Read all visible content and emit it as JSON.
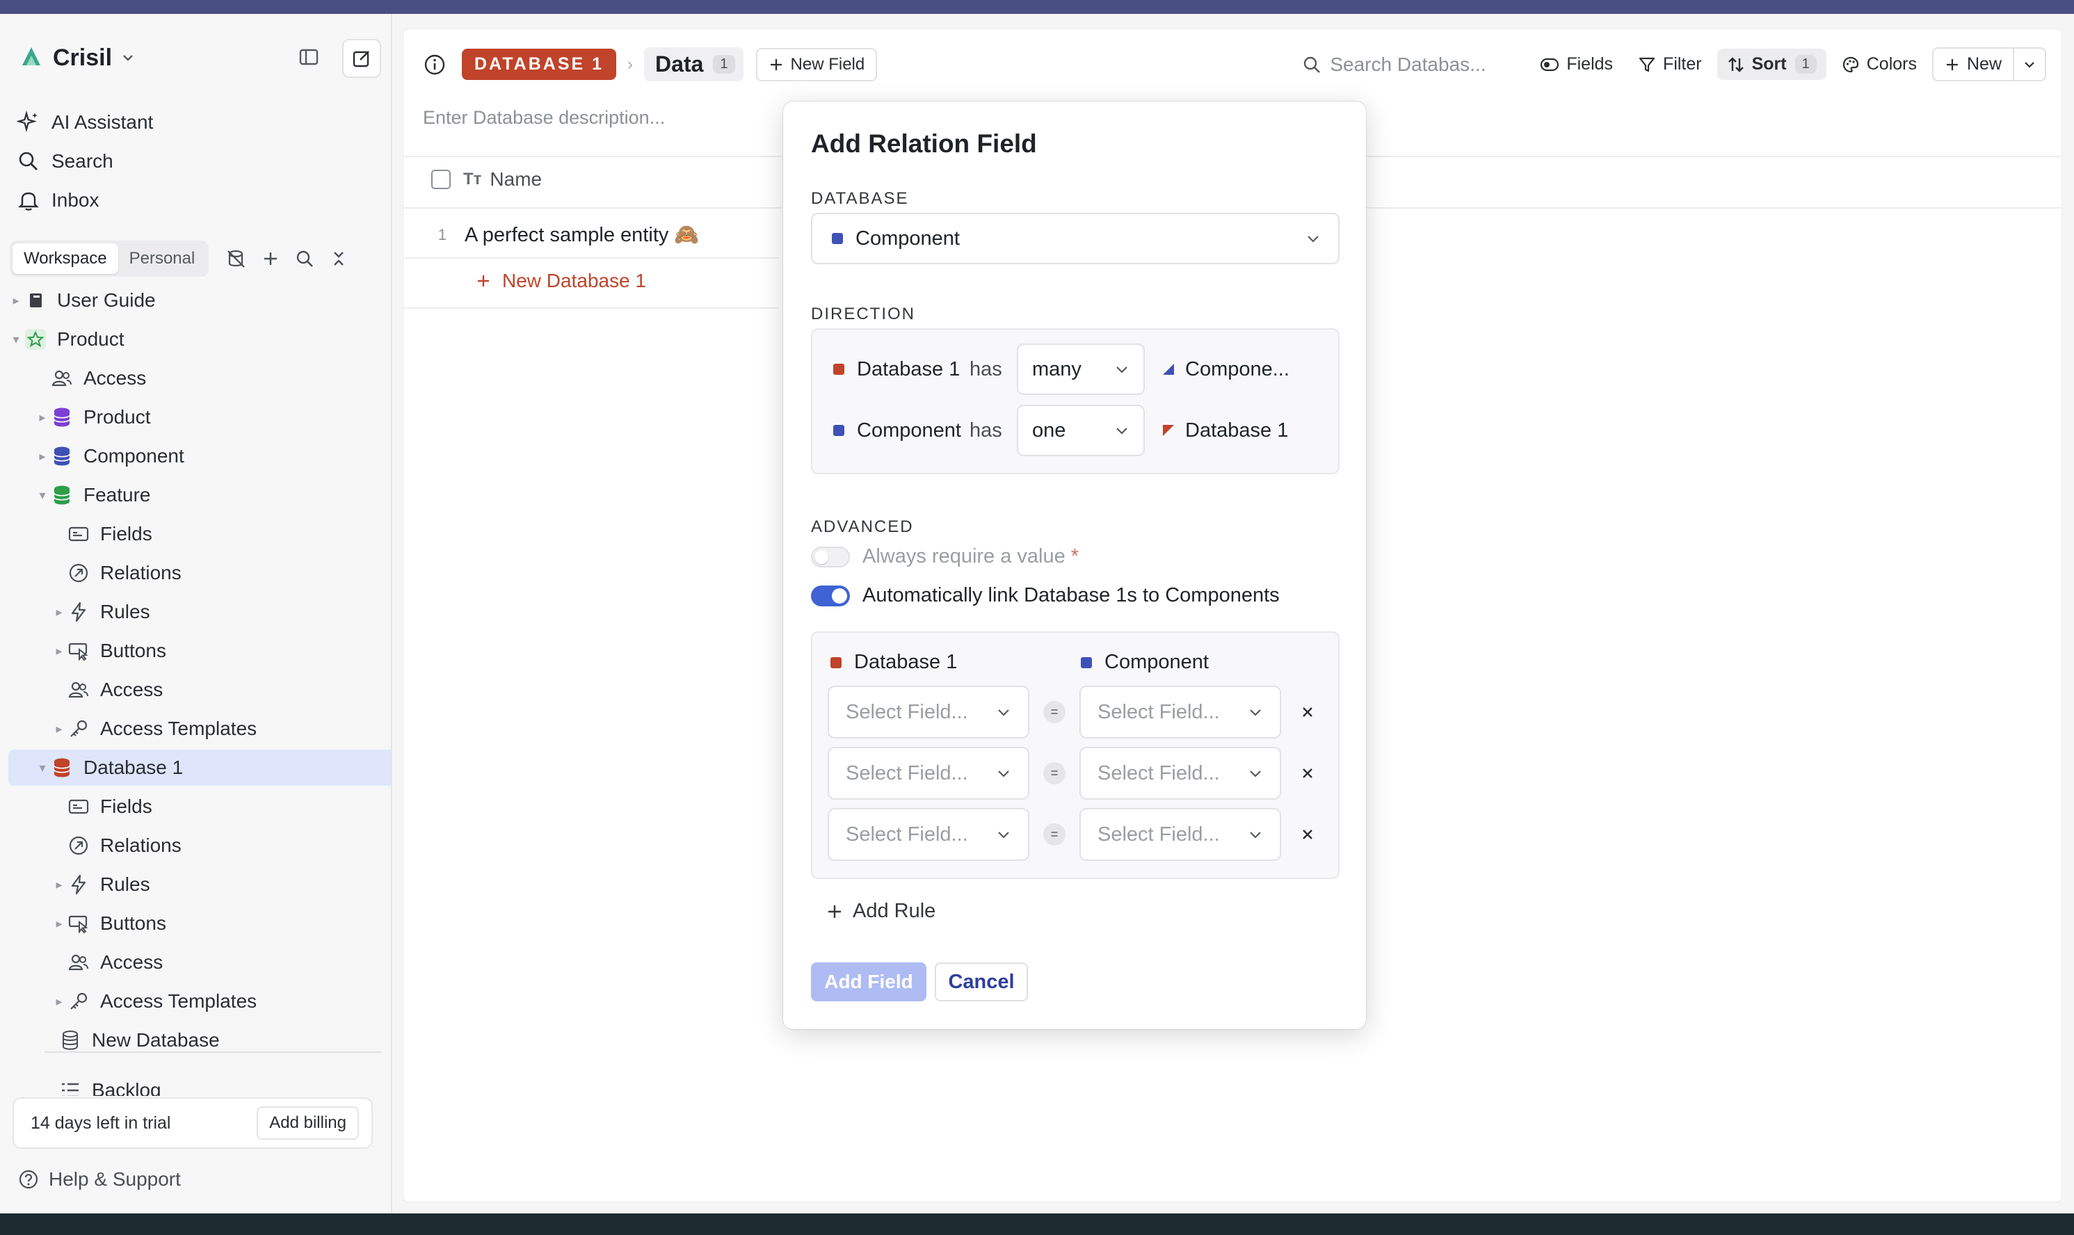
{
  "sidebar": {
    "workspace_name": "Crisil",
    "nav": [
      {
        "label": "AI Assistant",
        "icon": "sparkle-icon"
      },
      {
        "label": "Search",
        "icon": "search-icon"
      },
      {
        "label": "Inbox",
        "icon": "bell-icon"
      }
    ],
    "scope_tabs": [
      "Workspace",
      "Personal"
    ],
    "active_scope": "Workspace",
    "tree": [
      {
        "label": "User Guide",
        "icon": "book-icon"
      },
      {
        "label": "Product",
        "icon": "star-icon"
      },
      {
        "label": "Access",
        "icon": "users-icon"
      },
      {
        "label": "Product",
        "icon": "database-icon",
        "color": "#7b3fd4"
      },
      {
        "label": "Component",
        "icon": "database-icon",
        "color": "#3f51b5"
      },
      {
        "label": "Feature",
        "icon": "database-icon",
        "color": "#2e9e4a"
      },
      {
        "label": "Fields",
        "icon": "fields-icon"
      },
      {
        "label": "Relations",
        "icon": "relations-icon"
      },
      {
        "label": "Rules",
        "icon": "bolt-icon"
      },
      {
        "label": "Buttons",
        "icon": "cursor-icon"
      },
      {
        "label": "Access",
        "icon": "users-icon"
      },
      {
        "label": "Access Templates",
        "icon": "key-icon"
      },
      {
        "label": "Database 1",
        "icon": "database-icon",
        "color": "#c0432a"
      },
      {
        "label": "Fields",
        "icon": "fields-icon"
      },
      {
        "label": "Relations",
        "icon": "relations-icon"
      },
      {
        "label": "Rules",
        "icon": "bolt-icon"
      },
      {
        "label": "Buttons",
        "icon": "cursor-icon"
      },
      {
        "label": "Access",
        "icon": "users-icon"
      },
      {
        "label": "Access Templates",
        "icon": "key-icon"
      },
      {
        "label": "New Database",
        "icon": "database-outline-icon"
      },
      {
        "label": "Backlog",
        "icon": "list-icon"
      }
    ],
    "trial_days": "14 days",
    "trial_suffix": " left in trial",
    "add_billing": "Add billing",
    "help": "Help & Support"
  },
  "header": {
    "database_badge": "DATABASE 1",
    "view_name": "Data",
    "view_count": "1",
    "new_field": "New Field",
    "search_placeholder": "Search Databas...",
    "fields": "Fields",
    "filter": "Filter",
    "sort": "Sort",
    "sort_count": "1",
    "colors": "Colors",
    "new": "New"
  },
  "table": {
    "description_placeholder": "Enter Database description...",
    "column_name": "Name",
    "rows": [
      {
        "num": "1",
        "name": "A perfect sample entity 🙈"
      }
    ],
    "new_row": "New Database 1"
  },
  "modal": {
    "title": "Add Relation Field",
    "database_label": "DATABASE",
    "database_value": "Component",
    "direction_label": "DIRECTION",
    "direction": [
      {
        "source": "Database 1",
        "has": "has",
        "cardinality": "many",
        "target": "Compone..."
      },
      {
        "source": "Component",
        "has": "has",
        "cardinality": "one",
        "target": "Database 1"
      }
    ],
    "advanced_label": "ADVANCED",
    "require_value": "Always require a value",
    "require_star": "*",
    "require_value_on": false,
    "auto_link": "Automatically link Database 1s to Components",
    "auto_link_on": true,
    "rules_left_header": "Database 1",
    "rules_right_header": "Component",
    "rules": [
      {
        "left": "Select Field...",
        "op": "=",
        "right": "Select Field..."
      },
      {
        "left": "Select Field...",
        "op": "=",
        "right": "Select Field..."
      },
      {
        "left": "Select Field...",
        "op": "=",
        "right": "Select Field..."
      }
    ],
    "add_rule": "Add Rule",
    "add_field": "Add Field",
    "cancel": "Cancel"
  },
  "colors": {
    "database1": "#c0432a",
    "component": "#3f51b5",
    "product": "#7b3fd4",
    "feature": "#2e9e4a",
    "accent": "#3f63d4"
  }
}
